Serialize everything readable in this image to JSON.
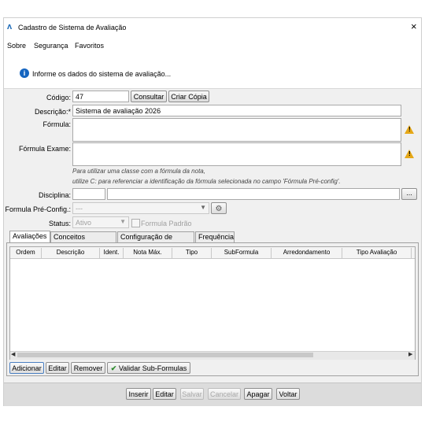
{
  "window": {
    "title": "Cadastro de Sistema de Avaliação",
    "close": "×"
  },
  "menu": [
    "Sobre",
    "Segurança",
    "Favoritos"
  ],
  "banner": {
    "message": "Informe os dados do sistema de avaliação..."
  },
  "form": {
    "codigo_label": "Código:",
    "codigo_value": "47",
    "consultar": "Consultar",
    "criar_copia": "Criar Cópia",
    "descricao_label": "Descrição:*",
    "descricao_value": "Sistema de avaliação 2026",
    "formula_label": "Fórmula:",
    "formula_exame_label": "Fórmula Exame:",
    "hint_line1": "Para utilizar uma classe com a fórmula da nota,",
    "hint_line2": "utilize C: para referenciar a identificação da fórmula selecionada no campo 'Fórmula Pré-config'.",
    "disciplina_label": "Disciplina:",
    "disciplina_btn": "...",
    "formula_pre_label": "Formula Pré-Config.:",
    "formula_pre_value": "---",
    "status_label": "Status:",
    "status_value": "Ativo",
    "formula_padrao": "Formula Padrão"
  },
  "tabs": [
    "Avaliações",
    "Conceitos Objetivos",
    "Configuração de Notas",
    "Frequência"
  ],
  "grid": {
    "columns": [
      "Ordem",
      "Descrição",
      "Ident.",
      "Nota Máx.",
      "Tipo",
      "SubFormula",
      "Arredondamento",
      "Tipo Avaliação"
    ]
  },
  "grid_buttons": [
    "Adicionar",
    "Editar",
    "Remover",
    "Validar Sub-Formulas"
  ],
  "footer_buttons": [
    "Inserir",
    "Editar",
    "Salvar",
    "Cancelar",
    "Apagar",
    "Voltar"
  ]
}
